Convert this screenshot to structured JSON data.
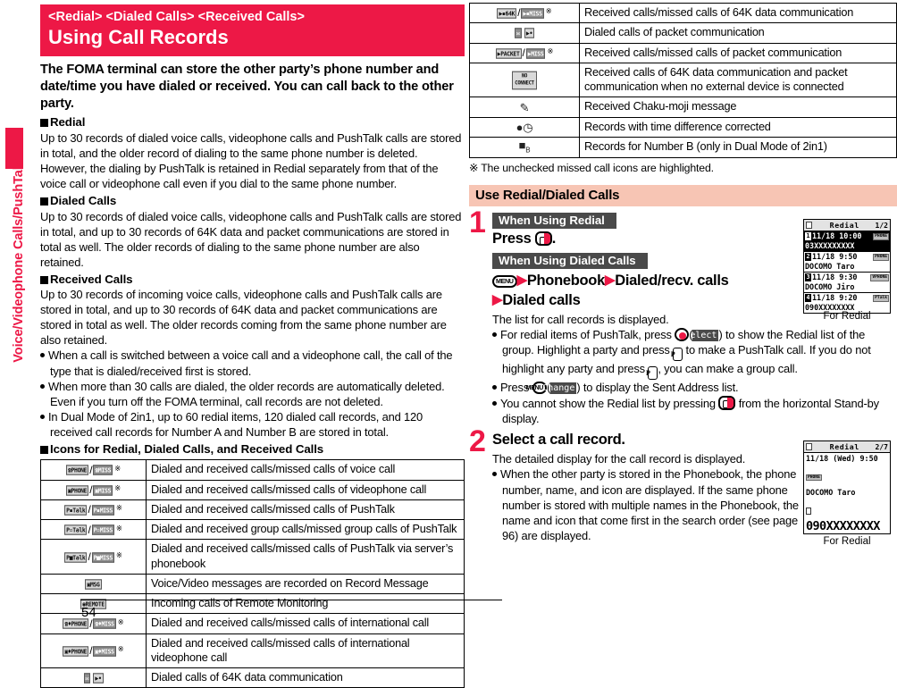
{
  "side_tab": {
    "label": "Voice/Videophone Calls/PushTalk"
  },
  "page_number": "54",
  "banner": {
    "kicker": "<Redial> <Dialed Calls> <Received Calls>",
    "title": "Using Call Records",
    "color": "#ED1846"
  },
  "intro": "The FOMA terminal can store the other party’s phone number and date/time you have dialed or received. You can call back to the other party.",
  "sections": [
    {
      "heading": "Redial",
      "text": "Up to 30 records of dialed voice calls, videophone calls and PushTalk calls are stored in total, and the older record of dialing to the same phone number is deleted. However, the dialing by PushTalk is retained in Redial separately from that of the voice call or videophone call even if you dial to the same phone number."
    },
    {
      "heading": "Dialed Calls",
      "text": "Up to 30 records of dialed voice calls, videophone calls and PushTalk calls are stored in total, and up to 30 records of 64K data and packet communications are stored in total as well. The older records of dialing to the same phone number are also retained."
    },
    {
      "heading": "Received Calls",
      "text": "Up to 30 records of incoming voice calls, videophone calls and PushTalk calls are stored in total, and up to 30 records of 64K data and packet communications are stored in total as well. The older records coming from the same phone number are also retained."
    }
  ],
  "bullets": [
    "When a call is switched between a voice call and a videophone call, the call of the type that is dialed/received first is stored.",
    "When more than 30 calls are dialed, the older records are automatically deleted. Even if you turn off the FOMA terminal, call records are not deleted.",
    "In Dual Mode of 2in1, up to 60 redial items, 120 dialed call records, and 120 received call records for Number A and Number B are stored in total."
  ],
  "icon_table_heading": "Icons for Redial, Dialed Calls, and Received Calls",
  "icon_rows_left": [
    {
      "icons": [
        "PHONE",
        "MISS"
      ],
      "ref": true,
      "desc": "Dialed and received calls/missed calls of voice call"
    },
    {
      "icons": [
        "PHONE",
        "MISS"
      ],
      "ref": true,
      "desc": "Dialed and received calls/missed calls of videophone call"
    },
    {
      "icons": [
        "Talk",
        "MISS"
      ],
      "ref": true,
      "desc": "Dialed and received calls/missed calls of PushTalk"
    },
    {
      "icons": [
        "Talk",
        "MISS"
      ],
      "ref": true,
      "desc": "Dialed and received group calls/missed group calls of PushTalk"
    },
    {
      "icons": [
        "Talk",
        "MISS"
      ],
      "ref": true,
      "desc": "Dialed and received calls/missed calls of PushTalk via server’s phonebook"
    },
    {
      "icons": [
        "MSG"
      ],
      "ref": false,
      "desc": "Voice/Video messages are recorded on Record Message"
    },
    {
      "icons": [
        "REMOTE"
      ],
      "ref": false,
      "desc": "Incoming calls of Remote Monitoring"
    },
    {
      "icons": [
        "PHONE",
        "MISS"
      ],
      "ref": true,
      "desc": "Dialed and received calls/missed calls of international call"
    },
    {
      "icons": [
        "PHONE",
        "MISS"
      ],
      "ref": true,
      "desc": "Dialed and received calls/missed calls of international videophone call"
    },
    {
      "icons": [
        "mail",
        "arrow"
      ],
      "ref": false,
      "desc": "Dialed calls of 64K data communication"
    }
  ],
  "icon_rows_right": [
    {
      "icons": [
        "64K",
        "MISS"
      ],
      "ref": true,
      "desc": "Received calls/missed calls of 64K data communication"
    },
    {
      "icons": [
        "mail",
        "arrow"
      ],
      "ref": false,
      "desc": "Dialed calls of packet communication"
    },
    {
      "icons": [
        "PACKET",
        "MISS"
      ],
      "ref": true,
      "desc": "Received calls/missed calls of packet communication"
    },
    {
      "icons": [
        "NO CONNECT"
      ],
      "ref": false,
      "desc": "Received calls of 64K data communication and packet communication when no external device is connected"
    },
    {
      "icons": [
        "chakumoji"
      ],
      "ref": false,
      "desc": "Received Chaku-moji message"
    },
    {
      "icons": [
        "clock"
      ],
      "ref": false,
      "desc": "Records with time difference corrected"
    },
    {
      "icons": [
        "numberB"
      ],
      "ref": false,
      "desc": "Records for Number B (only in Dual Mode of 2in1)"
    }
  ],
  "footnote": "※ The unchecked missed call icons are highlighted.",
  "band": {
    "label": "Use Redial/Dialed Calls",
    "color": "#F7C5B4"
  },
  "step1": {
    "number": "1",
    "subhead_a": "When Using Redial",
    "press_label": "Press",
    "press_suffix": ".",
    "subhead_b": "When Using Dialed Calls",
    "menu_key": "MENU",
    "path_1": "Phonebook",
    "path_2": "Dialed/recv. calls",
    "path_3": "Dialed calls",
    "result": "The list for call records is displayed.",
    "bullets": [
      {
        "pre": "For redial items of PushTalk, press",
        "soft": "Select",
        "mid": ") to show the Redial list of the group. Highlight a party and press",
        "mid2": "to make a PushTalk call. If you do not highlight any party and press",
        "post": ", you can make a group call."
      },
      {
        "pre": "Press",
        "soft": "Change",
        "post": ") to display the Sent Address list."
      },
      {
        "pre": "You cannot show the Redial list by pressing",
        "post": "from the horizontal Stand-by display."
      }
    ]
  },
  "step2": {
    "number": "2",
    "title": "Select a call record.",
    "result": "The detailed display for the call record is displayed.",
    "bullet": "When the other party is stored in the Phonebook, the phone number, name, and icon are displayed. If the same phone number is stored with multiple names in the Phonebook, the name and icon that come first in the search order (see page 96) are displayed."
  },
  "screen_redial": {
    "title": "Redial",
    "page": "1/2",
    "caption": "For Redial",
    "rows": [
      {
        "index": "1",
        "date": "11/18 10:00",
        "number": "03XXXXXXXXX",
        "chip": "PHONE",
        "selected": true
      },
      {
        "index": "2",
        "date": "11/18  9:50",
        "number": "DOCOMO Taro",
        "chip": "PHONE",
        "selected": false
      },
      {
        "index": "3",
        "date": "11/18  9:30",
        "number": "DOCOMO Jiro",
        "chip": "VPHONE",
        "selected": false
      },
      {
        "index": "4",
        "date": "11/18  9:20",
        "number": "090XXXXXXXX",
        "chip": "PTalk",
        "selected": false
      }
    ]
  },
  "screen_detail": {
    "title": "Redial",
    "page": "2/7",
    "caption": "For Redial",
    "datetime": "11/18 (Wed)  9:50",
    "name": "DOCOMO Taro",
    "number": "090XXXXXXXX"
  }
}
